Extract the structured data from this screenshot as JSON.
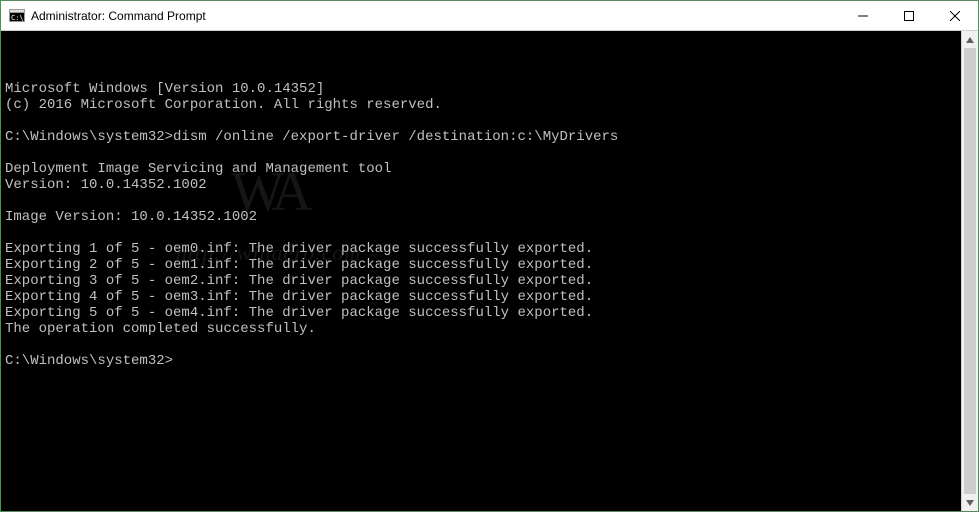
{
  "window": {
    "title": "Administrator: Command Prompt"
  },
  "terminal": {
    "lines": [
      "Microsoft Windows [Version 10.0.14352]",
      "(c) 2016 Microsoft Corporation. All rights reserved.",
      "",
      "C:\\Windows\\system32>dism /online /export-driver /destination:c:\\MyDrivers",
      "",
      "Deployment Image Servicing and Management tool",
      "Version: 10.0.14352.1002",
      "",
      "Image Version: 10.0.14352.1002",
      "",
      "Exporting 1 of 5 - oem0.inf: The driver package successfully exported.",
      "Exporting 2 of 5 - oem1.inf: The driver package successfully exported.",
      "Exporting 3 of 5 - oem2.inf: The driver package successfully exported.",
      "Exporting 4 of 5 - oem3.inf: The driver package successfully exported.",
      "Exporting 5 of 5 - oem4.inf: The driver package successfully exported.",
      "The operation completed successfully.",
      "",
      "C:\\Windows\\system32>"
    ]
  },
  "watermark": {
    "logo": "WA",
    "url": "http://winaero.com"
  }
}
